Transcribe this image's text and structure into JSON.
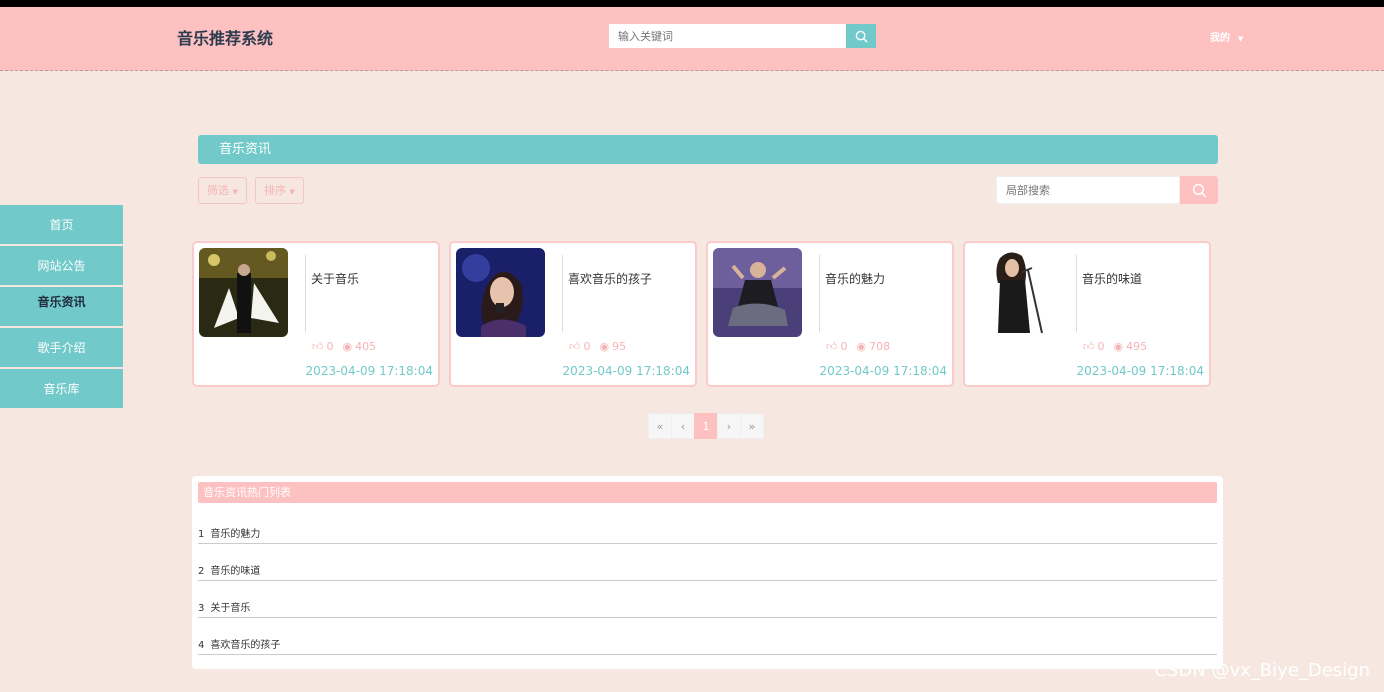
{
  "header": {
    "brand": "音乐推荐系统",
    "search_placeholder": "输入关键词",
    "user_menu": "我的"
  },
  "sidebar": {
    "items": [
      {
        "label": "首页"
      },
      {
        "label": "网站公告"
      },
      {
        "label": "音乐资讯"
      },
      {
        "label": "歌手介绍"
      },
      {
        "label": "音乐库"
      }
    ]
  },
  "section": {
    "title": "音乐资讯",
    "filter_label": "筛选",
    "sort_label": "排序",
    "local_search_placeholder": "局部搜索"
  },
  "cards": [
    {
      "title": "关于音乐",
      "likes": "0",
      "views": "405",
      "date": "2023-04-09 17:18:04"
    },
    {
      "title": "喜欢音乐的孩子",
      "likes": "0",
      "views": "95",
      "date": "2023-04-09 17:18:04"
    },
    {
      "title": "音乐的魅力",
      "likes": "0",
      "views": "708",
      "date": "2023-04-09 17:18:04"
    },
    {
      "title": "音乐的味道",
      "likes": "0",
      "views": "495",
      "date": "2023-04-09 17:18:04"
    }
  ],
  "pagination": {
    "first": "«",
    "prev": "‹",
    "current": "1",
    "next": "›",
    "last": "»"
  },
  "hot_list": {
    "title": "音乐资讯热门列表",
    "items": [
      {
        "index": "1",
        "title": "音乐的魅力"
      },
      {
        "index": "2",
        "title": "音乐的味道"
      },
      {
        "index": "3",
        "title": "关于音乐"
      },
      {
        "index": "4",
        "title": "喜欢音乐的孩子"
      }
    ]
  },
  "watermark": "CSDN @vx_Biye_Design"
}
